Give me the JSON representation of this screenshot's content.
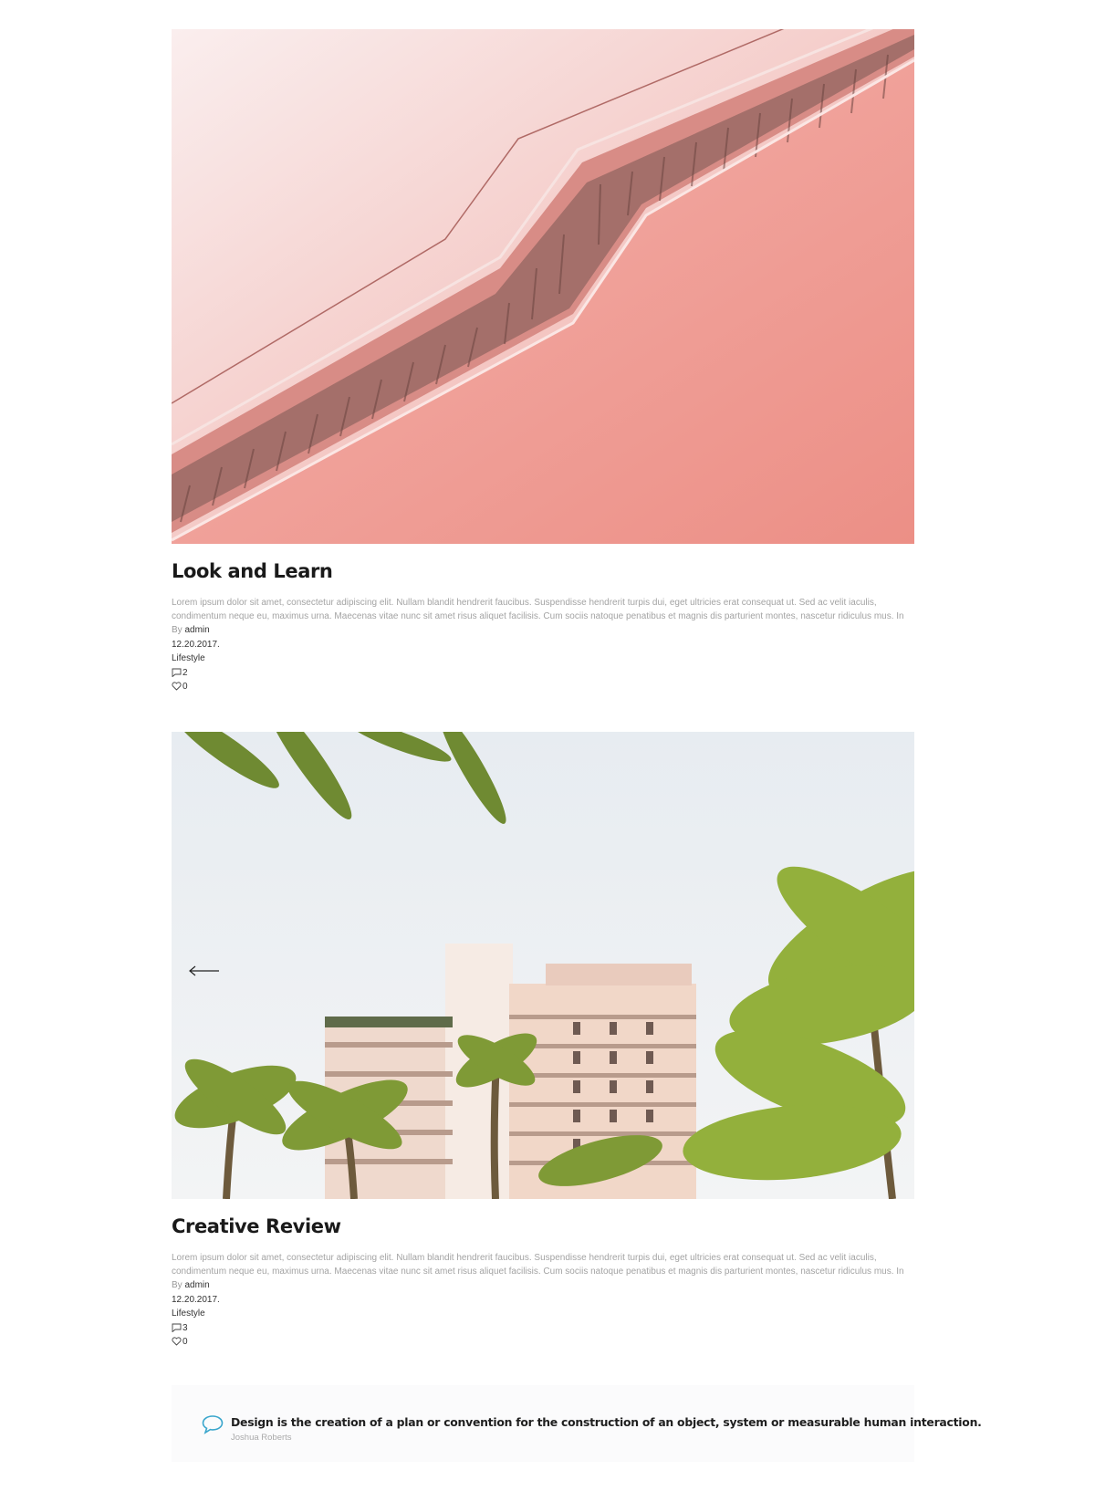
{
  "posts": [
    {
      "title": "Look and Learn",
      "excerpt": "Lorem ipsum dolor sit amet, consectetur adipiscing elit. Nullam blandit hendrerit faucibus. Suspendisse hendrerit turpis dui, eget ultricies erat consequat ut. Sed ac velit iaculis, condimentum neque eu, maximus urna. Maecenas vitae nunc sit amet risus aliquet facilisis. Cum sociis natoque penatibus et magnis dis parturient montes, nascetur ridiculus mus. In facilisis mi sit amet metus sagittis ...",
      "by_label": "By",
      "author": "admin",
      "date": "12.20.2017.",
      "category": "Lifestyle",
      "comments": "2",
      "likes": "0"
    },
    {
      "title": "Creative Review",
      "excerpt": "Lorem ipsum dolor sit amet, consectetur adipiscing elit. Nullam blandit hendrerit faucibus. Suspendisse hendrerit turpis dui, eget ultricies erat consequat ut. Sed ac velit iaculis, condimentum neque eu, maximus urna. Maecenas vitae nunc sit amet risus aliquet facilisis. Cum sociis natoque penatibus et magnis dis parturient montes, nascetur ridiculus mus. In facilisis mi sit amet metus sagittis ...",
      "by_label": "By",
      "author": "admin",
      "date": "12.20.2017.",
      "category": "Lifestyle",
      "comments": "3",
      "likes": "0"
    }
  ],
  "quote": {
    "text": "Design is the creation of a plan or convention for the construction of an object, system or measurable human interaction.",
    "author": "Joshua Roberts"
  },
  "colors": {
    "quote_icon": "#3aa6cc",
    "excerpt": "#a3a3a3",
    "title": "#1a1a1a"
  }
}
